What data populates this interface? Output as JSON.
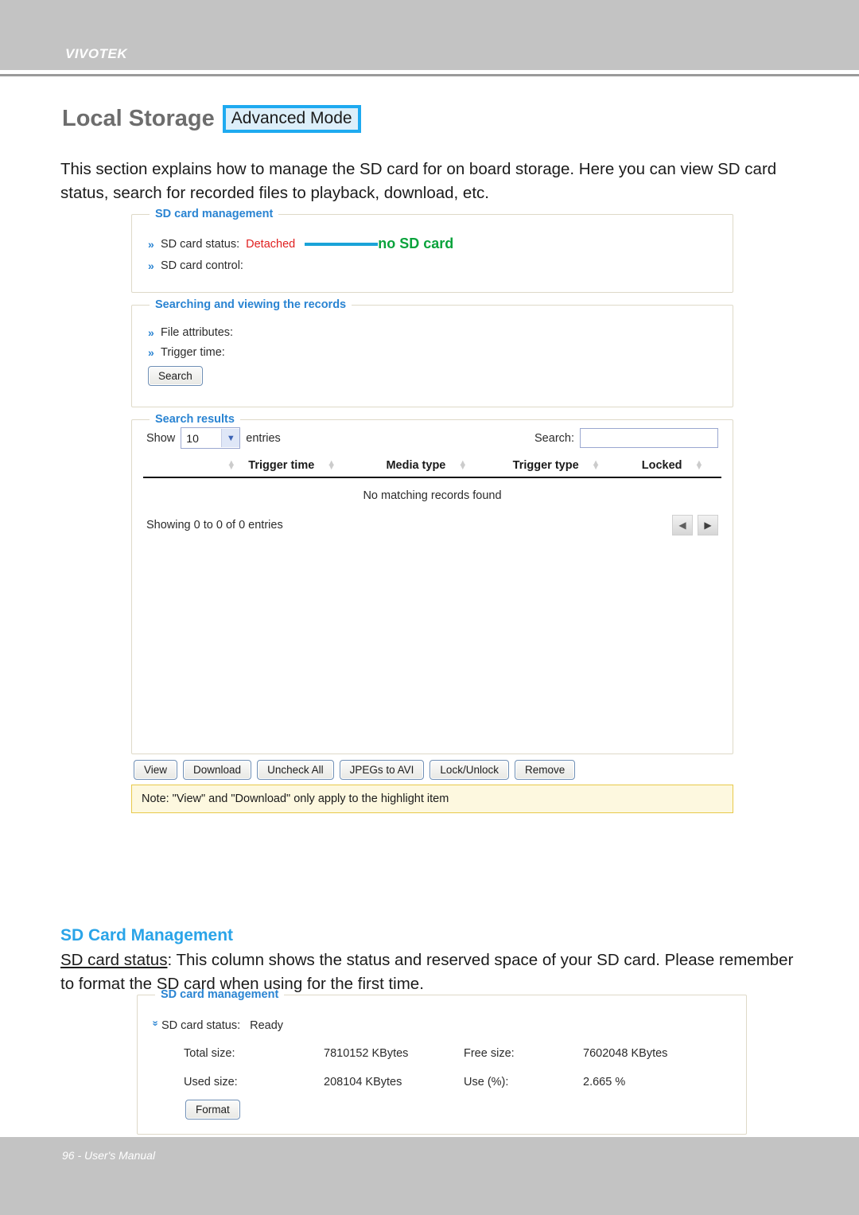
{
  "header": {
    "brand": "VIVOTEK"
  },
  "footer": {
    "text": "96 - User's Manual"
  },
  "doc": {
    "title": "Local Storage",
    "mode_badge": "Advanced Mode",
    "intro": "This section explains how to manage the SD card for on board storage. Here you can view SD card status, search for recorded files to playback, download, etc."
  },
  "sd_management": {
    "legend": "SD card management",
    "status_label": "SD card status:",
    "status_value": "Detached",
    "callout": "no SD card",
    "control_label": "SD card control:",
    "chevron": "»"
  },
  "searching": {
    "legend": "Searching and viewing the records",
    "file_attributes_label": "File attributes:",
    "trigger_time_label": "Trigger time:",
    "search_button": "Search",
    "chevron": "»"
  },
  "search_results": {
    "legend": "Search results",
    "show_label": "Show",
    "show_value": "10",
    "entries_label": "entries",
    "search_label": "Search:",
    "search_value": "",
    "search_placeholder": "",
    "columns": [
      "",
      "Trigger time",
      "Media type",
      "Trigger type",
      "Locked"
    ],
    "empty_message": "No matching records found",
    "showing_text": "Showing 0 to 0 of 0 entries",
    "pager": {
      "prev": "◀",
      "next": "▶"
    },
    "sort_up": "▲",
    "sort_down": "▼"
  },
  "action_buttons": [
    "View",
    "Download",
    "Uncheck All",
    "JPEGs to AVI",
    "Lock/Unlock",
    "Remove"
  ],
  "note": "Note: \"View\" and \"Download\" only apply to the highlight item",
  "section2": {
    "heading": "SD Card Management",
    "body_underlined": "SD card status",
    "body_rest": ": This column shows the status and reserved space of your SD card. Please remember to format the SD card when using for the first time.",
    "legend": "SD card management",
    "chevron_down": "»",
    "status_label": "SD card status:",
    "status_value": "Ready",
    "total_size_label": "Total size:",
    "total_size_value": "7810152  KBytes",
    "free_size_label": "Free size:",
    "free_size_value": "7602048  KBytes",
    "used_size_label": "Used size:",
    "used_size_value": "208104  KBytes",
    "use_pct_label": "Use (%):",
    "use_pct_value": "2.665 %",
    "format_button": "Format"
  },
  "colors": {
    "brand_bar": "#c3c3c3",
    "accent_blue": "#2a84d2",
    "heading_blue": "#2aa4e8",
    "status_red": "#e02020",
    "callout_green": "#0aa33c",
    "callout_line": "#1aa3d8",
    "badge_border": "#1eaaf0",
    "note_bg": "#fdf8df",
    "note_border": "#e8c94a"
  }
}
